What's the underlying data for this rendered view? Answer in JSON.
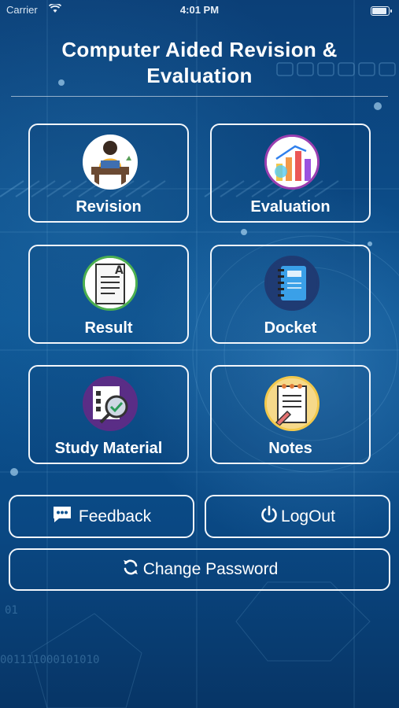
{
  "status_bar": {
    "carrier": "Carrier",
    "time": "4:01 PM"
  },
  "header": {
    "title_line1": "Computer Aided Revision &",
    "title_line2": "Evaluation"
  },
  "tiles": [
    {
      "label": "Revision",
      "icon": "student-at-desk-icon"
    },
    {
      "label": "Evaluation",
      "icon": "analytics-chart-icon"
    },
    {
      "label": "Result",
      "icon": "graded-paper-icon"
    },
    {
      "label": "Docket",
      "icon": "notebook-icon"
    },
    {
      "label": "Study Material",
      "icon": "document-magnifier-icon"
    },
    {
      "label": "Notes",
      "icon": "notepad-pencil-icon"
    }
  ],
  "buttons": {
    "feedback": "Feedback",
    "logout": "LogOut",
    "change_password": "Change Password"
  },
  "colors": {
    "background": "#0c5391",
    "border": "#f2f6fb",
    "text": "#ffffff"
  }
}
